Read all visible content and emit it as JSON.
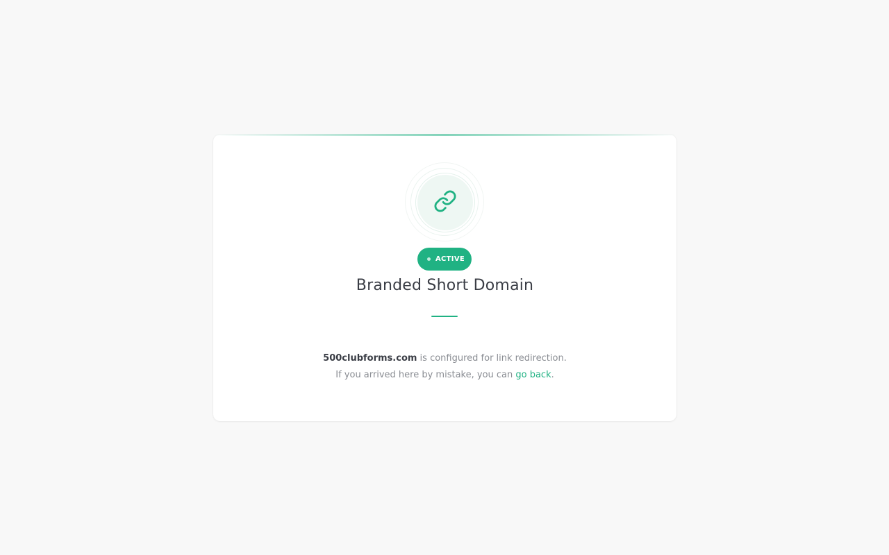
{
  "status_badge": {
    "label": "ACTIVE",
    "color": "#20b283"
  },
  "icon": {
    "name": "link-icon",
    "color": "#20b283"
  },
  "title": "Branded Short Domain",
  "message": {
    "domain": "500clubforms.com",
    "line1_suffix": " is configured for link redirection.",
    "line2_prefix": "If you arrived here by mistake, you can ",
    "link_label": "go back",
    "line2_suffix": "."
  },
  "colors": {
    "accent": "#20b283",
    "background": "#f8f8f8",
    "card": "#ffffff",
    "title": "#3a3d45",
    "muted_text": "#8a8d93"
  }
}
